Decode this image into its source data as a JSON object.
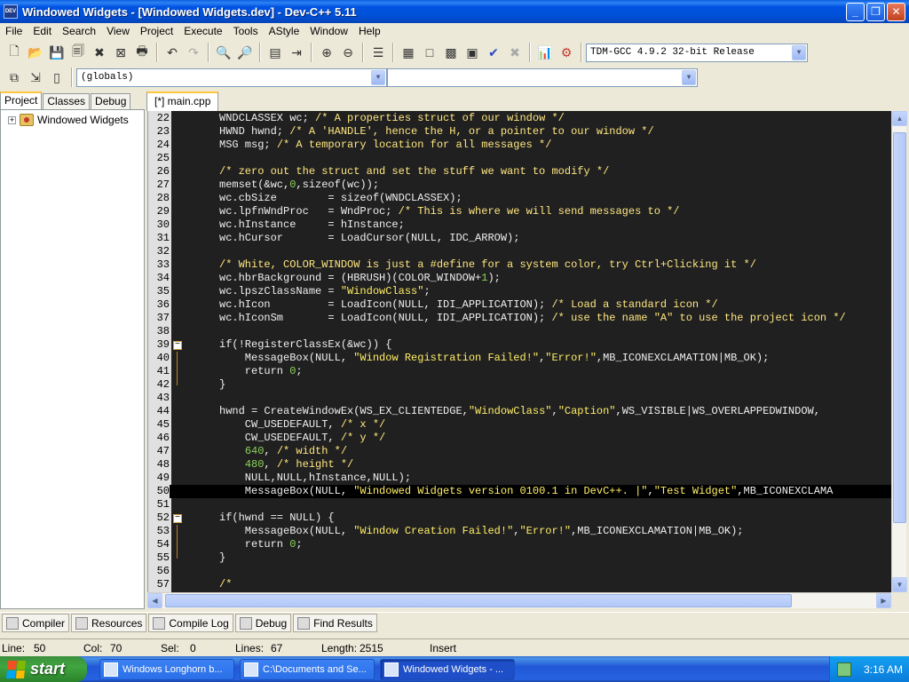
{
  "window": {
    "title": "Windowed Widgets - [Windowed Widgets.dev] - Dev-C++ 5.11",
    "icon_text": "DEV"
  },
  "menu": [
    "File",
    "Edit",
    "Search",
    "View",
    "Project",
    "Execute",
    "Tools",
    "AStyle",
    "Window",
    "Help"
  ],
  "toolbar": {
    "compiler_select": "TDM-GCC 4.9.2 32-bit Release",
    "scope_select": "(globals)",
    "member_select": ""
  },
  "left_panel": {
    "tabs": [
      "Project",
      "Classes",
      "Debug"
    ],
    "active_tab": "Project",
    "tree_root": "Windowed Widgets"
  },
  "editor": {
    "tab_label": "[*] main.cpp",
    "lines": [
      {
        "n": "22",
        "code": "WNDCLASSEX wc; /* A properties struct of our window */"
      },
      {
        "n": "23",
        "code": "HWND hwnd; /* A 'HANDLE', hence the H, or a pointer to our window */"
      },
      {
        "n": "24",
        "code": "MSG msg; /* A temporary location for all messages */"
      },
      {
        "n": "25",
        "code": ""
      },
      {
        "n": "26",
        "code": "/* zero out the struct and set the stuff we want to modify */"
      },
      {
        "n": "27",
        "code": "memset(&wc,0,sizeof(wc));"
      },
      {
        "n": "28",
        "code": "wc.cbSize        = sizeof(WNDCLASSEX);"
      },
      {
        "n": "29",
        "code": "wc.lpfnWndProc   = WndProc; /* This is where we will send messages to */"
      },
      {
        "n": "30",
        "code": "wc.hInstance     = hInstance;"
      },
      {
        "n": "31",
        "code": "wc.hCursor       = LoadCursor(NULL, IDC_ARROW);"
      },
      {
        "n": "32",
        "code": ""
      },
      {
        "n": "33",
        "code": "/* White, COLOR_WINDOW is just a #define for a system color, try Ctrl+Clicking it */"
      },
      {
        "n": "34",
        "code": "wc.hbrBackground = (HBRUSH)(COLOR_WINDOW+1);"
      },
      {
        "n": "35",
        "code": "wc.lpszClassName = \"WindowClass\";"
      },
      {
        "n": "36",
        "code": "wc.hIcon         = LoadIcon(NULL, IDI_APPLICATION); /* Load a standard icon */"
      },
      {
        "n": "37",
        "code": "wc.hIconSm       = LoadIcon(NULL, IDI_APPLICATION); /* use the name \"A\" to use the project icon */"
      },
      {
        "n": "38",
        "code": ""
      },
      {
        "n": "39",
        "code": "if(!RegisterClassEx(&wc)) {"
      },
      {
        "n": "40",
        "code": "    MessageBox(NULL, \"Window Registration Failed!\",\"Error!\",MB_ICONEXCLAMATION|MB_OK);"
      },
      {
        "n": "41",
        "code": "    return 0;"
      },
      {
        "n": "42",
        "code": "}"
      },
      {
        "n": "43",
        "code": ""
      },
      {
        "n": "44",
        "code": "hwnd = CreateWindowEx(WS_EX_CLIENTEDGE,\"WindowClass\",\"Caption\",WS_VISIBLE|WS_OVERLAPPEDWINDOW,"
      },
      {
        "n": "45",
        "code": "    CW_USEDEFAULT, /* x */"
      },
      {
        "n": "46",
        "code": "    CW_USEDEFAULT, /* y */"
      },
      {
        "n": "47",
        "code": "    640, /* width */"
      },
      {
        "n": "48",
        "code": "    480, /* height */"
      },
      {
        "n": "49",
        "code": "    NULL,NULL,hInstance,NULL);"
      },
      {
        "n": "50",
        "code": "    MessageBox(NULL, \"Windowed Widgets version 0100.1 in DevC++. |\",\"Test Widget\",MB_ICONEXCLAMA"
      },
      {
        "n": "51",
        "code": ""
      },
      {
        "n": "52",
        "code": "if(hwnd == NULL) {"
      },
      {
        "n": "53",
        "code": "    MessageBox(NULL, \"Window Creation Failed!\",\"Error!\",MB_ICONEXCLAMATION|MB_OK);"
      },
      {
        "n": "54",
        "code": "    return 0;"
      },
      {
        "n": "55",
        "code": "}"
      },
      {
        "n": "56",
        "code": ""
      },
      {
        "n": "57",
        "code": "/*"
      }
    ]
  },
  "bottom_tabs": [
    "Compiler",
    "Resources",
    "Compile Log",
    "Debug",
    "Find Results"
  ],
  "status": {
    "line_label": "Line:",
    "line": "50",
    "col_label": "Col:",
    "col": "70",
    "sel_label": "Sel:",
    "sel": "0",
    "lines_label": "Lines:",
    "lines": "67",
    "length_label": "Length:",
    "length": "2515",
    "mode": "Insert"
  },
  "taskbar": {
    "start": "start",
    "tasks": [
      "Windows Longhorn b...",
      "C:\\Documents and Se...",
      "Windowed Widgets - ..."
    ],
    "clock": "3:16 AM"
  },
  "colors": {
    "editor_bg": "#202020",
    "gutter_bg": "#E0E0E0",
    "title_blue": "#0050D6",
    "string_yellow": "#FFEE66",
    "number_green": "#8BD25A"
  }
}
